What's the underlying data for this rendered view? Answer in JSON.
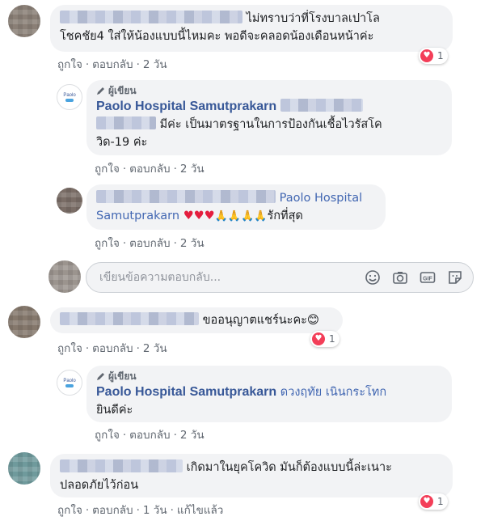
{
  "comments": [
    {
      "text": "ไม่ทราบว่าที่โรงบาลเปาโล โชคชัย4 ใส่ให้น้องแบบนี้ไหมคะ พอดีจะคลอดน้องเดือนหน้าค่ะ",
      "text_line1": "ไม่ทราบว่าที่โรงบาลเปาโล",
      "text_line2": "โชคชัย4 ใส่ให้น้องแบบนี้ไหมคะ พอดีจะคลอดน้องเดือนหน้าค่ะ",
      "like": "ถูกใจ",
      "reply": "ตอบกลับ",
      "time": "2 วัน",
      "reaction_count": "1",
      "replies": [
        {
          "author_badge": "ผู้เขียน",
          "author": "Paolo Hospital Samutprakarn",
          "text_line1": "มีค่ะ เป็นมาตรฐานในการป้องกันเชื้อไวรัสโค",
          "text_line2": "วิด-19 ค่ะ",
          "like": "ถูกใจ",
          "reply": "ตอบกลับ",
          "time": "2 วัน"
        },
        {
          "mention_1": "Paolo Hospital",
          "mention_2": "Samutprakarn",
          "hearts": "♥♥♥",
          "prayers": "🙏🙏🙏🙏",
          "text_end": "รักที่สุด",
          "like": "ถูกใจ",
          "reply": "ตอบกลับ",
          "time": "2 วัน"
        }
      ],
      "composer_placeholder": "เขียนข้อความตอบกลับ..."
    },
    {
      "text": "ขออนุญาตแชร์นะคะ😊",
      "like": "ถูกใจ",
      "reply": "ตอบกลับ",
      "time": "2 วัน",
      "reaction_count": "1",
      "replies": [
        {
          "author_badge": "ผู้เขียน",
          "author": "Paolo Hospital Samutprakarn",
          "text_line1": "ดวงฤทัย เนินกระโทก",
          "text_line2": "ยินดีค่ะ",
          "like": "ถูกใจ",
          "reply": "ตอบกลับ",
          "time": "2 วัน"
        }
      ]
    },
    {
      "text_line1": "เกิดมาในยุคโควิด มันก็ต้องแบบนี้ล่ะเนาะ",
      "text_line2": "ปลอดภัยไว้ก่อน",
      "like": "ถูกใจ",
      "reply": "ตอบกลับ",
      "time": "1 วัน",
      "edited": "แก้ไขแล้ว",
      "reaction_count": "1"
    }
  ],
  "logo_text": "Paolo",
  "colors": {
    "link": "#385898",
    "bubble": "#f2f3f5",
    "heart": "#f33e58",
    "meta": "#606770"
  },
  "icons": [
    "pencil-icon",
    "heart-reaction-icon",
    "smiley-icon",
    "camera-icon",
    "gif-icon",
    "sticker-icon"
  ]
}
